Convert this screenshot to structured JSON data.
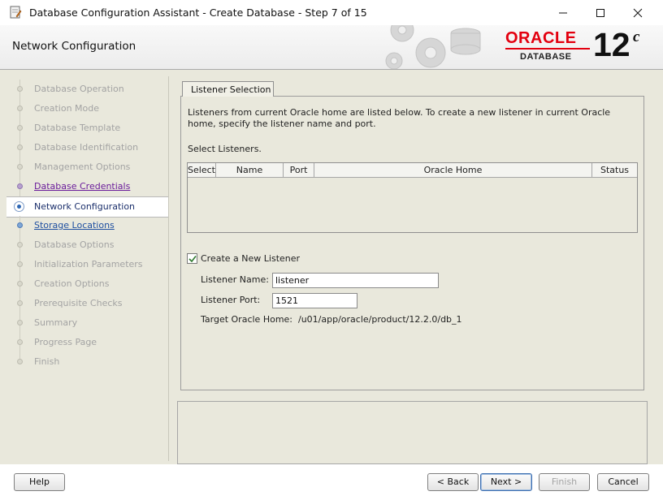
{
  "window": {
    "title": "Database Configuration Assistant - Create Database - Step 7 of 15",
    "icons": [
      "app-icon",
      "minimize-icon",
      "maximize-icon",
      "close-icon"
    ]
  },
  "header": {
    "page_title": "Network Configuration",
    "logo": {
      "brand": "ORACLE",
      "product": "DATABASE",
      "version": "12",
      "suffix": "c"
    }
  },
  "steps": [
    {
      "label": "Database Operation",
      "state": "inactive"
    },
    {
      "label": "Creation Mode",
      "state": "inactive"
    },
    {
      "label": "Database Template",
      "state": "inactive"
    },
    {
      "label": "Database Identification",
      "state": "inactive"
    },
    {
      "label": "Management Options",
      "state": "inactive"
    },
    {
      "label": "Database Credentials",
      "state": "done"
    },
    {
      "label": "Network Configuration",
      "state": "current"
    },
    {
      "label": "Storage Locations",
      "state": "next"
    },
    {
      "label": "Database Options",
      "state": "inactive"
    },
    {
      "label": "Initialization Parameters",
      "state": "inactive"
    },
    {
      "label": "Creation Options",
      "state": "inactive"
    },
    {
      "label": "Prerequisite Checks",
      "state": "inactive"
    },
    {
      "label": "Summary",
      "state": "inactive"
    },
    {
      "label": "Progress Page",
      "state": "inactive"
    },
    {
      "label": "Finish",
      "state": "inactive"
    }
  ],
  "tab": {
    "label": "Listener Selection"
  },
  "content": {
    "description": "Listeners from current Oracle home are listed below. To create a new listener in current Oracle home, specify the listener name and port.",
    "select_label": "Select Listeners.",
    "table_headers": [
      "Select",
      "Name",
      "Port",
      "Oracle Home",
      "Status"
    ],
    "create_new_listener": {
      "label": "Create a New Listener",
      "checked": true
    },
    "listener_name": {
      "label": "Listener Name:",
      "value": "listener"
    },
    "listener_port": {
      "label": "Listener Port:",
      "value": "1521"
    },
    "target_home": {
      "label": "Target Oracle Home:",
      "value": "/u01/app/oracle/product/12.2.0/db_1"
    }
  },
  "buttons": {
    "help": "Help",
    "back": "< Back",
    "next": "Next >",
    "finish": "Finish",
    "cancel": "Cancel"
  },
  "colors": {
    "panel_bg": "#e9e8dc",
    "oracle_red": "#e3000f",
    "done_link": "#6a1b9a",
    "next_link": "#1f4fa0"
  }
}
